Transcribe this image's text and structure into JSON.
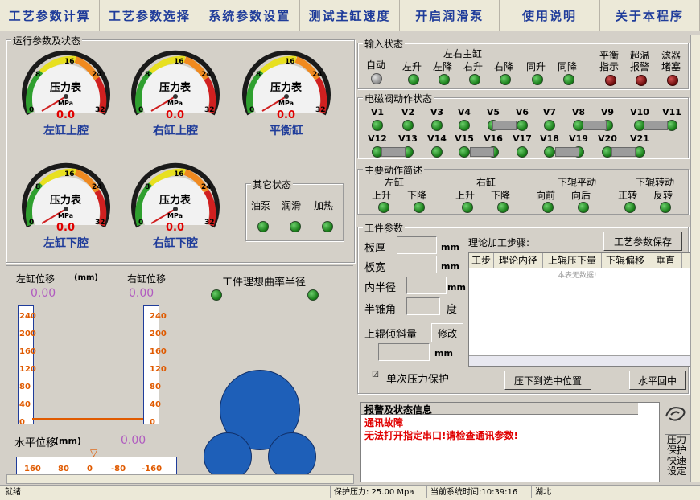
{
  "menu": [
    "工艺参数计算",
    "工艺参数选择",
    "系统参数设置",
    "测试主缸速度",
    "开启润滑泵",
    "使用说明",
    "关于本程序"
  ],
  "left": {
    "group_title": "运行参数及状态",
    "gauges": [
      {
        "title": "压力表",
        "value": "0.0",
        "label": "左缸上腔",
        "unit": "MPa",
        "ticks": [
          "0",
          "8",
          "16",
          "24",
          "32"
        ]
      },
      {
        "title": "压力表",
        "value": "0.0",
        "label": "右缸上腔",
        "unit": "MPa",
        "ticks": [
          "0",
          "8",
          "16",
          "24",
          "32"
        ]
      },
      {
        "title": "压力表",
        "value": "0.0",
        "label": "平衡缸",
        "unit": "MPa",
        "ticks": [
          "0",
          "8",
          "16",
          "24",
          "32"
        ]
      },
      {
        "title": "压力表",
        "value": "0.0",
        "label": "左缸下腔",
        "unit": "MPa",
        "ticks": [
          "0",
          "8",
          "16",
          "24",
          "32"
        ]
      },
      {
        "title": "压力表",
        "value": "0.0",
        "label": "右缸下腔",
        "unit": "MPa",
        "ticks": [
          "0",
          "8",
          "16",
          "24",
          "32"
        ]
      }
    ],
    "other_status": {
      "title": "其它状态",
      "items": [
        "油泵",
        "润滑",
        "加热"
      ]
    },
    "left_disp_label": "左缸位移",
    "mm_unit": "(mm)",
    "right_disp_label": "右缸位移",
    "curve_label": "工件理想曲率半径",
    "left_disp_value": "0.00",
    "right_disp_value": "0.00",
    "scale_ticks": [
      "240",
      "200",
      "160",
      "120",
      "80",
      "40",
      "0"
    ],
    "horiz_label": "水平位移",
    "horiz_unit": "(mm)",
    "horiz_value": "0.00",
    "horiz_ticks": [
      "160",
      "80",
      "0",
      "-80",
      "-160"
    ]
  },
  "inputs": {
    "title": "输入状态",
    "auto": "自动",
    "cyl_group": "左右主缸",
    "cyl_items": [
      "左升",
      "左降",
      "右升",
      "右降",
      "同升",
      "同降"
    ],
    "balance": [
      "平衡",
      "指示"
    ],
    "overheat": [
      "超温",
      "报警"
    ],
    "filter": [
      "滤器",
      "堵塞"
    ]
  },
  "valves": {
    "title": "电磁阀动作状态",
    "row1": [
      "V1",
      "V2",
      "V3",
      "V4",
      "V5",
      "V6",
      "V7",
      "V8",
      "V9",
      "V10",
      "V11"
    ],
    "row2": [
      "V12",
      "V13",
      "V14",
      "V15",
      "V16",
      "V17",
      "V18",
      "V19",
      "V20",
      "V21"
    ]
  },
  "actions": {
    "title": "主要动作简述",
    "groups": [
      {
        "name": "左缸",
        "items": [
          "上升",
          "下降"
        ]
      },
      {
        "name": "右缸",
        "items": [
          "上升",
          "下降"
        ]
      },
      {
        "name": "下辊平动",
        "items": [
          "向前",
          "向后"
        ]
      },
      {
        "name": "下辊转动",
        "items": [
          "正转",
          "反转"
        ]
      }
    ]
  },
  "workpiece": {
    "title": "工件参数",
    "thickness": "板厚",
    "width": "板宽",
    "inner_radius": "内半径",
    "half_cone": "半锥角",
    "tilt": "上辊倾斜量",
    "mm": "mm",
    "deg": "度",
    "modify_btn": "修改",
    "steps_label": "理论加工步骤:",
    "save_btn": "工艺参数保存",
    "columns": [
      "工步",
      "理论内径",
      "上辊压下量",
      "下辊偏移",
      "垂直"
    ],
    "empty_text": "本表无数据!",
    "single_protect": "单次压力保护",
    "press_btn": "压下到选中位置",
    "center_btn": "水平回中"
  },
  "alarm": {
    "title": "报警及状态信息",
    "line1": "通讯故障",
    "line2": "无法打开指定串口!请检查通讯参数!"
  },
  "side_buttons": [
    "压力",
    "保护",
    "快速",
    "设定"
  ],
  "status": {
    "ready": "就绪",
    "pressure": "保护压力:  25.00 Mpa",
    "time": "当前系统时间:10:39:16",
    "company": "湖北"
  },
  "colors": {
    "accent": "#1f3c9a",
    "value_red": "#e00000",
    "roll_blue": "#1e5fb8",
    "led_green": "#1a8a1a",
    "led_red": "#8a1010"
  },
  "icons": {
    "logo": "swirl-logo-icon",
    "horiz_pointer": "triangle-down-icon"
  }
}
